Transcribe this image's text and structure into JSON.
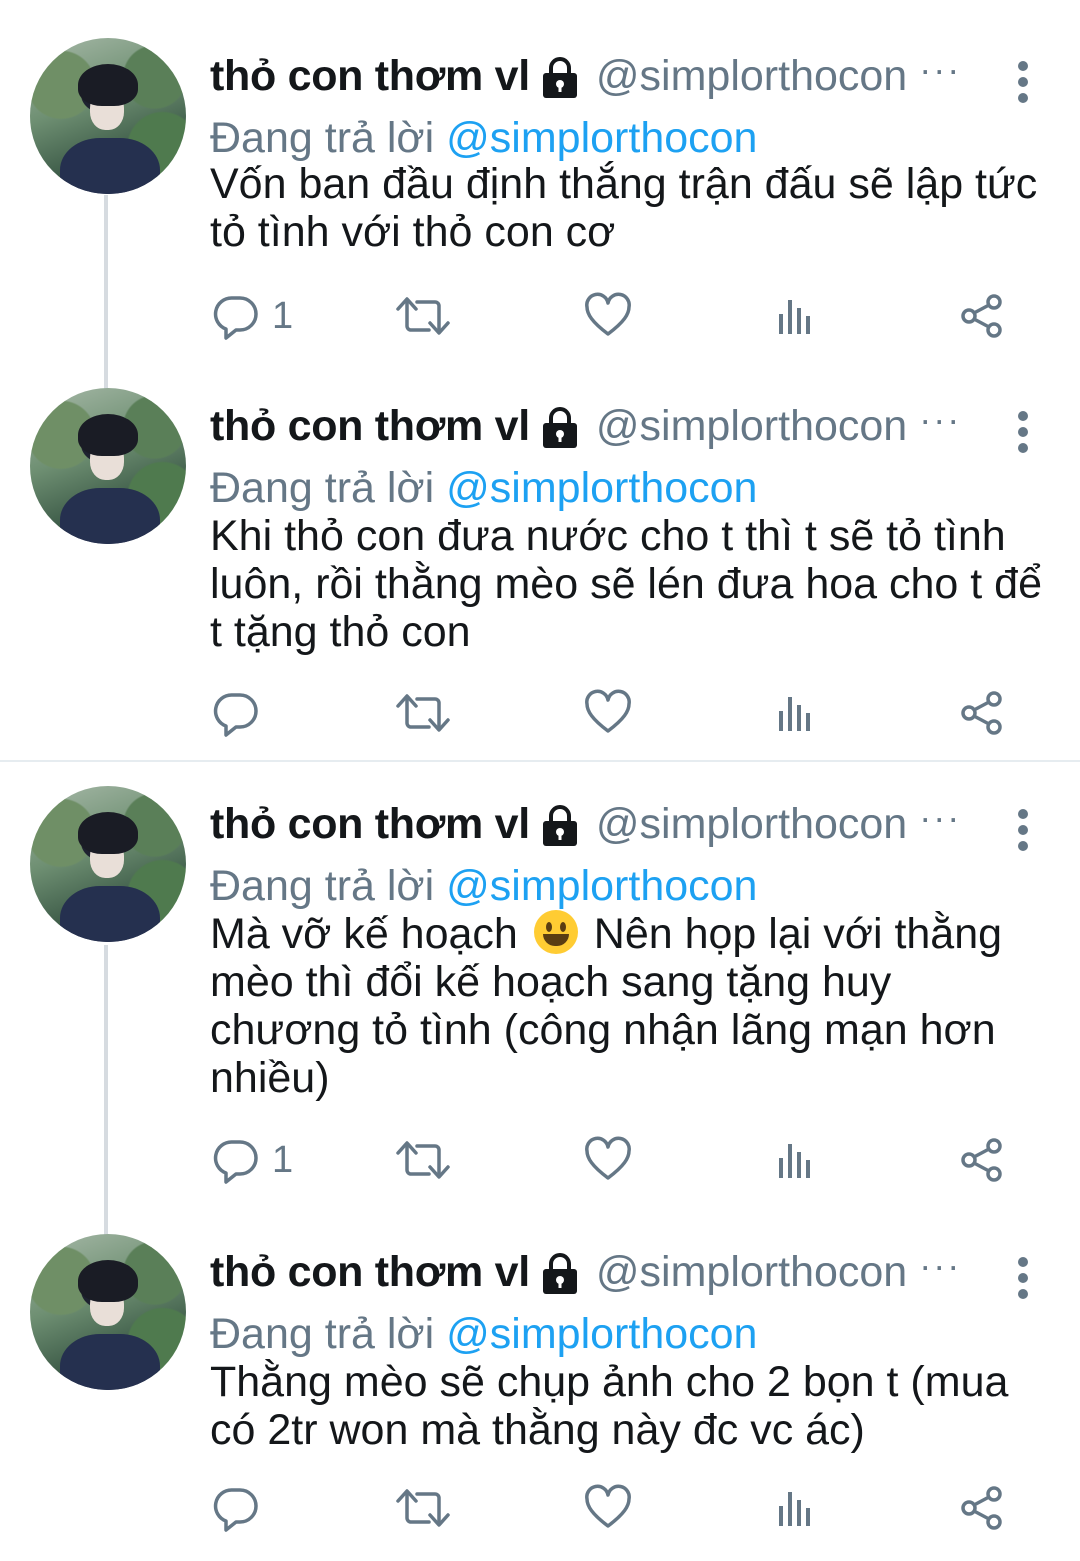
{
  "tweets": [
    {
      "name": "thỏ con thơm vl",
      "handle": "@simplorthocon",
      "more": "···",
      "reply_prefix": "Đang trả lời",
      "reply_to": "@simplorthocon",
      "text": "Vốn ban đầu định thắng trận đấu sẽ lập tức tỏ tình với thỏ con cơ",
      "reply_count": "1"
    },
    {
      "name": "thỏ con thơm vl",
      "handle": "@simplorthocon",
      "more": "···",
      "reply_prefix": "Đang trả lời",
      "reply_to": "@simplorthocon",
      "text": "Khi thỏ con đưa nước cho t thì t sẽ tỏ tình luôn, rồi thằng mèo sẽ lén đưa hoa cho t để t tặng thỏ con",
      "reply_count": ""
    },
    {
      "name": "thỏ con thơm vl",
      "handle": "@simplorthocon",
      "more": "···",
      "reply_prefix": "Đang trả lời",
      "reply_to": "@simplorthocon",
      "text_before_emoji": "Mà vỡ kế hoạch",
      "text_after_emoji": "Nên họp lại với thằng mèo thì đổi kế hoạch sang tặng huy chương tỏ tình (công nhận lãng mạn hơn nhiều)",
      "reply_count": "1"
    },
    {
      "name": "thỏ con thơm vl",
      "handle": "@simplorthocon",
      "more": "···",
      "reply_prefix": "Đang trả lời",
      "reply_to": "@simplorthocon",
      "text": "Thằng mèo sẽ chụp ảnh cho 2 bọn t (mua có 2tr won mà thằng này đc vc ác)",
      "reply_count": ""
    }
  ],
  "icons": {
    "lock": "lock-icon",
    "more": "vertical-dots-icon",
    "reply": "speech-bubble-icon",
    "retweet": "retweet-icon",
    "like": "heart-icon",
    "stats": "bar-chart-icon",
    "share": "share-icon"
  },
  "colors": {
    "link": "#1da1f2",
    "secondary": "#657786",
    "text": "#14171a",
    "thread_line": "#d6dbe0"
  }
}
